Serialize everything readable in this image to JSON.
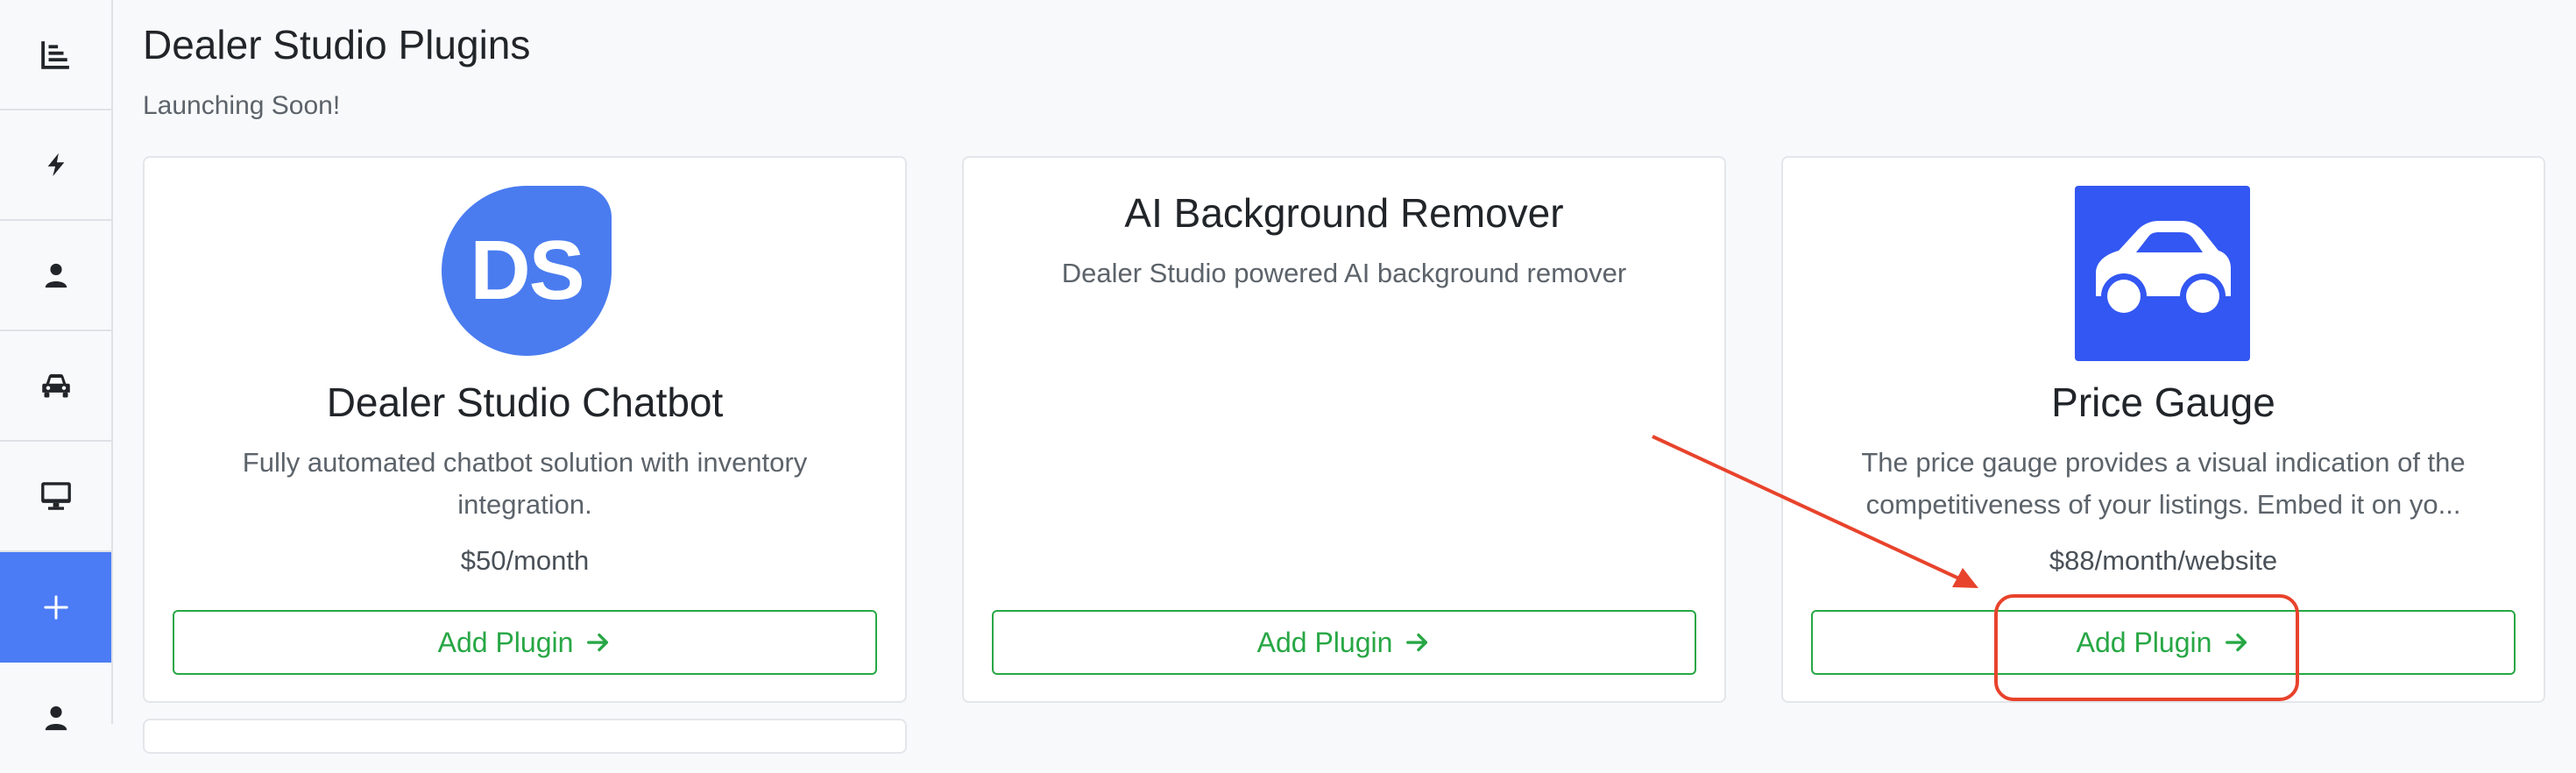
{
  "page": {
    "title": "Dealer Studio Plugins",
    "subtitle": "Launching Soon!"
  },
  "sidebar": {
    "items": [
      {
        "icon": "bar-chart-icon",
        "active": false
      },
      {
        "icon": "lightning-icon",
        "active": false
      },
      {
        "icon": "user-icon",
        "active": false
      },
      {
        "icon": "car-icon",
        "active": false
      },
      {
        "icon": "monitor-icon",
        "active": false
      },
      {
        "icon": "plus-icon",
        "active": true
      },
      {
        "icon": "user-icon",
        "active": false
      }
    ]
  },
  "plugins": [
    {
      "logo_text": "DS",
      "title": "Dealer Studio Chatbot",
      "description_lines": [
        "Fully automated chatbot solution with inventory",
        "integration."
      ],
      "price": "$50/month",
      "button_label": "Add Plugin"
    },
    {
      "title": "AI Background Remover",
      "description_lines": [
        "Dealer Studio powered AI background remover"
      ],
      "button_label": "Add Plugin"
    },
    {
      "logo_icon": "car-icon",
      "title": "Price Gauge",
      "description_lines": [
        "The price gauge provides a visual indication of the",
        "competitiveness of your listings. Embed it on yo..."
      ],
      "price": "$88/month/website",
      "button_label": "Add Plugin"
    }
  ],
  "colors": {
    "accent": "#4b7bf5",
    "button_green": "#28a745",
    "annotation_red": "#e8432c",
    "ds_logo": "#4a7cf0",
    "price_gauge_logo": "#3357f2"
  }
}
